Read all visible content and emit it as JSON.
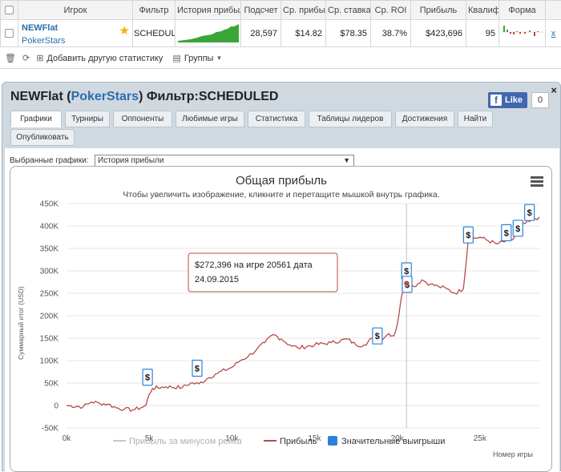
{
  "table": {
    "headers": [
      "",
      "Игрок",
      "Фильтр",
      "История прибыль",
      "Подсчет",
      "Ср. прибыль",
      "Ср. ставка",
      "Ср. ROI",
      "Прибыль",
      "Квалиф.",
      "Форма",
      ""
    ],
    "row": {
      "player": "NEWFlat",
      "site": "PokerStars",
      "filter": "SCHEDULED",
      "count": "28,597",
      "avg_profit": "$14.82",
      "avg_stake": "$78.35",
      "avg_roi": "38.7%",
      "profit": "$423,696",
      "ability": "95",
      "remove": "x"
    }
  },
  "toolbar": {
    "add_stat": "Добавить другую статистику",
    "groups": "Группы"
  },
  "panel": {
    "player": "NEWFlat",
    "site": "PokerStars",
    "filter_label": "Фильтр:",
    "filter": "SCHEDULED",
    "fb_like": "Like",
    "fb_count": "0",
    "close": "×"
  },
  "tabs": [
    "Графики",
    "Турниры",
    "Оппоненты",
    "Любимые игры",
    "Статистика",
    "Таблицы лидеров",
    "Достижения",
    "Найти",
    "Опубликовать"
  ],
  "selector": {
    "label": "Выбранные графики:",
    "value": "История прибыли"
  },
  "colors": {
    "profit_line": "#b84a4a",
    "rake_line": "#c8c8c8",
    "big_win_marker": "#2b82d9",
    "sparkline": "#3aa63a",
    "tab_active": "#ffffff"
  },
  "chart_data": {
    "type": "line",
    "title": "Общая прибыль",
    "subtitle": "Чтобы увеличить изображение, кликните и перетащите мышкой внутрь графика.",
    "ylabel": "Суммарный итог (USD)",
    "xlabel": "Номер игры",
    "xlim": [
      0,
      28597
    ],
    "ylim": [
      -50000,
      450000
    ],
    "x_ticks": [
      "0k",
      "5k",
      "10k",
      "15k",
      "20k",
      "25k"
    ],
    "y_ticks": [
      "-50K",
      "0",
      "50K",
      "100K",
      "150K",
      "200K",
      "250K",
      "300K",
      "350K",
      "400K",
      "450K"
    ],
    "series": [
      {
        "name": "Прибыль",
        "x": [
          0,
          1000,
          1500,
          2000,
          2500,
          3000,
          3500,
          4000,
          4500,
          4800,
          5000,
          5200,
          6000,
          7000,
          7500,
          8000,
          8500,
          9000,
          10000,
          10500,
          11000,
          11500,
          12000,
          12500,
          13000,
          13500,
          14000,
          15000,
          16000,
          17000,
          17500,
          18000,
          18500,
          19000,
          19500,
          19800,
          20000,
          20300,
          20561,
          21000,
          21500,
          22000,
          22500,
          23000,
          23500,
          24000,
          24300,
          25000,
          26000,
          27000,
          27500,
          28000,
          28597
        ],
        "values": [
          0,
          -3000,
          8000,
          5000,
          3000,
          -5000,
          -8000,
          -10000,
          -5000,
          0,
          25000,
          38000,
          42000,
          40000,
          50000,
          48000,
          60000,
          70000,
          85000,
          100000,
          110000,
          125000,
          140000,
          158000,
          148000,
          135000,
          128000,
          135000,
          140000,
          148000,
          135000,
          135000,
          150000,
          148000,
          160000,
          155000,
          180000,
          250000,
          272396,
          265000,
          280000,
          270000,
          265000,
          260000,
          250000,
          260000,
          370000,
          375000,
          360000,
          370000,
          400000,
          410000,
          420000
        ]
      },
      {
        "name": "Прибыль за минусом рейка",
        "x": [],
        "values": []
      }
    ],
    "big_wins_x": [
      4900,
      7900,
      18800,
      20561,
      20600,
      24300,
      26600,
      27300,
      28000
    ],
    "big_wins_y": [
      63000,
      83000,
      155000,
      300000,
      270000,
      380000,
      385000,
      395000,
      430000
    ],
    "tooltip": {
      "profit": "$272,396",
      "game_label": "на игре",
      "game": "20561",
      "date_label": "дата",
      "date": "24.09.2015"
    },
    "legend": [
      "Прибыль за минусом рейка",
      "Прибыль",
      "Значительные выигрыши"
    ],
    "legend_position": "bottom"
  }
}
